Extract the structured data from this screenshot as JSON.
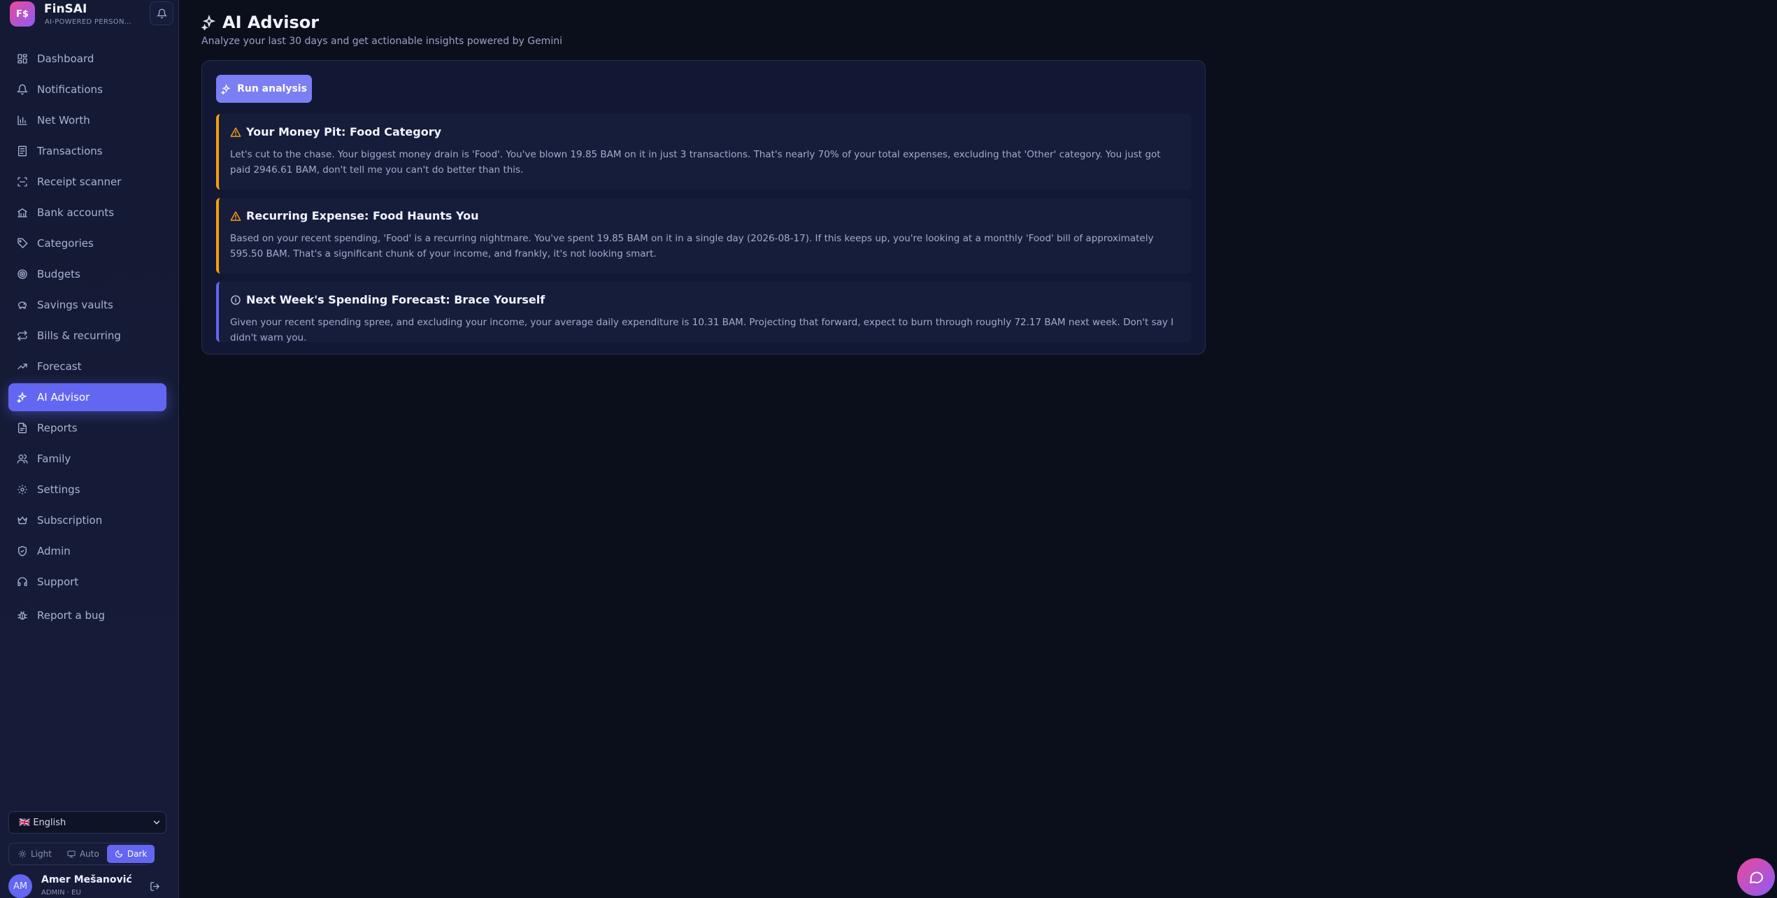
{
  "brand": {
    "logo_text": "F$",
    "name": "FinSAI",
    "tagline": "AI-POWERED PERSONAL FINANCE"
  },
  "nav": {
    "items": [
      {
        "label": "Dashboard",
        "icon": "dashboard-icon"
      },
      {
        "label": "Notifications",
        "icon": "bell-icon"
      },
      {
        "label": "Net Worth",
        "icon": "bar-chart-icon"
      },
      {
        "label": "Transactions",
        "icon": "receipt-icon"
      },
      {
        "label": "Receipt scanner",
        "icon": "scan-icon"
      },
      {
        "label": "Bank accounts",
        "icon": "bank-icon"
      },
      {
        "label": "Categories",
        "icon": "tag-icon"
      },
      {
        "label": "Budgets",
        "icon": "target-icon"
      },
      {
        "label": "Savings vaults",
        "icon": "piggy-bank-icon"
      },
      {
        "label": "Bills & recurring",
        "icon": "repeat-icon"
      },
      {
        "label": "Forecast",
        "icon": "trend-icon"
      },
      {
        "label": "AI Advisor",
        "icon": "sparkles-icon",
        "active": true
      },
      {
        "label": "Reports",
        "icon": "file-icon"
      },
      {
        "label": "Family",
        "icon": "users-icon"
      },
      {
        "label": "Settings",
        "icon": "gear-icon"
      },
      {
        "label": "Subscription",
        "icon": "crown-icon"
      },
      {
        "label": "Admin",
        "icon": "shield-icon"
      },
      {
        "label": "Support",
        "icon": "headset-icon"
      },
      {
        "label": "Report a bug",
        "icon": "bug-icon"
      }
    ]
  },
  "language": {
    "selected": "🇬🇧 English"
  },
  "theme": {
    "light": "Light",
    "auto": "Auto",
    "dark": "Dark",
    "selected": "Dark"
  },
  "user": {
    "initials": "AM",
    "name": "Amer Mešanović",
    "role": "ADMIN · EU"
  },
  "page": {
    "title": "AI Advisor",
    "subtitle": "Analyze your last 30 days and get actionable insights powered by Gemini",
    "run_button": "Run analysis"
  },
  "insights": [
    {
      "type": "warning",
      "title": "Your Money Pit: Food Category",
      "body": "Let's cut to the chase. Your biggest money drain is 'Food'. You've blown 19.85 BAM on it in just 3 transactions. That's nearly 70% of your total expenses, excluding that 'Other' category. You just got paid 2946.61 BAM, don't tell me you can't do better than this."
    },
    {
      "type": "warning",
      "title": "Recurring Expense: Food Haunts You",
      "body": "Based on your recent spending, 'Food' is a recurring nightmare. You've spent 19.85 BAM on it in a single day (2026-08-17). If this keeps up, you're looking at a monthly 'Food' bill of approximately 595.50 BAM. That's a significant chunk of your income, and frankly, it's not looking smart."
    },
    {
      "type": "info",
      "title": "Next Week's Spending Forecast: Brace Yourself",
      "body": "Given your recent spending spree, and excluding your income, your average daily expenditure is 10.31 BAM. Projecting that forward, expect to burn through roughly 72.17 BAM next week. Don't say I didn't warn you."
    }
  ],
  "colors": {
    "accent": "#6366f1",
    "warning": "#f59e0b",
    "background": "#0b0f1c"
  }
}
